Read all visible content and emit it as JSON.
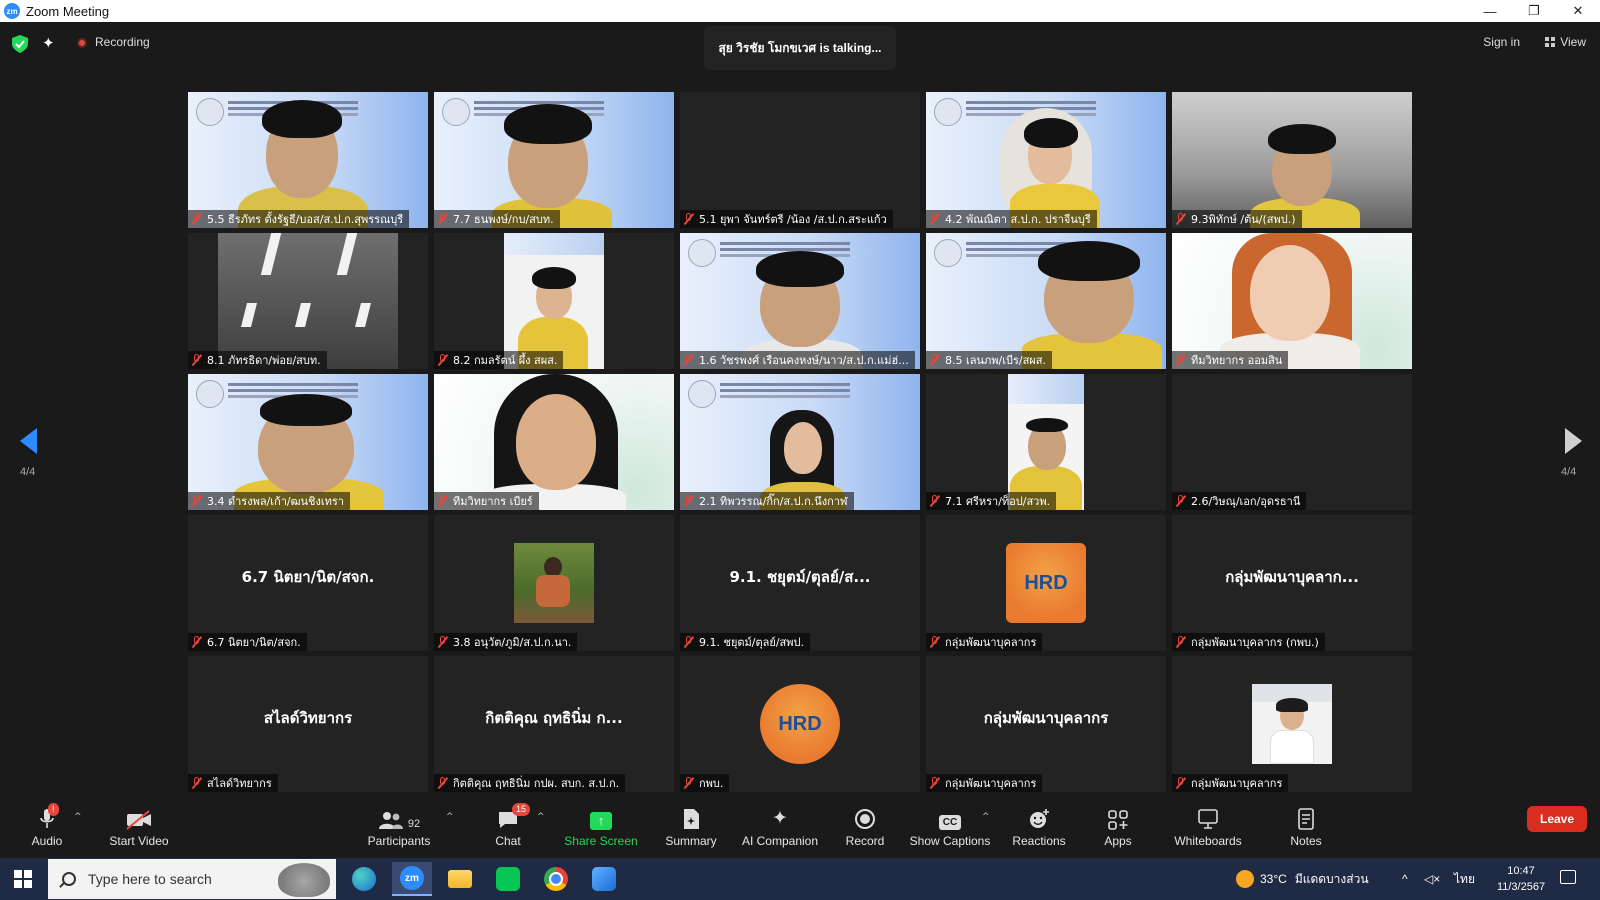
{
  "window": {
    "title": "Zoom Meeting",
    "logo_text": "zm",
    "minimize": "—",
    "restore": "❐",
    "close": "✕"
  },
  "topbar": {
    "recording": "Recording",
    "talking": "สุย วิรชัย โมกขเวศ is talking...",
    "sign_in": "Sign in",
    "view": "View"
  },
  "nav": {
    "page_left": "4/4",
    "page_right": "4/4"
  },
  "tiles": [
    {
      "type": "video",
      "name": "5.5 ธีรภัทร ตั้งรัฐธี/บอส/ส.ป.ก.สุพรรณบุรี"
    },
    {
      "type": "video",
      "name": "7.7 ธนพงษ์/กบ/สบท."
    },
    {
      "type": "video-off",
      "name": "5.1 ยุพา จันทร์ตรี /น้อง /ส.ป.ก.สระแก้ว"
    },
    {
      "type": "video",
      "name": "4.2 พัณณิตา ส.ป.ก. ปราจีนบุรี"
    },
    {
      "type": "video",
      "name": "9.3พิทักษ์ /ต้น/(สพป.)"
    },
    {
      "type": "video",
      "name": "8.1 ภัทรธิดา/พ่อย/สบท."
    },
    {
      "type": "video",
      "name": "8.2 กมลรัตน์ ผึ้ง สผส."
    },
    {
      "type": "video",
      "name": "1.6 วัชรพงศ์ เรือนคงหงษ์/นาว/ส.ป.ก.แม่ฮ่..."
    },
    {
      "type": "video",
      "name": "8.5 เลนภพ/เบีร/สผส."
    },
    {
      "type": "video",
      "name": "ทีมวิทยากร ออมสิน"
    },
    {
      "type": "video",
      "name": "3.4 ดำรงพล/เก้า/ฒนชิงเทรา"
    },
    {
      "type": "video",
      "name": "ทีมวิทยากร เบียร์"
    },
    {
      "type": "video",
      "name": "2.1 ทิพวรรณ/กิ๊ก/ส.ป.ก.นึงกาฬ"
    },
    {
      "type": "video",
      "name": "7.1 ศรีหรา/ท็อป/สวพ."
    },
    {
      "type": "video-off",
      "name": "2.6/วิษณุ/เอก/อุดรธานี"
    },
    {
      "type": "name",
      "display": "6.7 นิตยา/นิต/สจก.",
      "name": "6.7 นิตยา/นิต/สจก."
    },
    {
      "type": "photo",
      "name": "3.8 อนุวัต/ภูมิ/ส.ป.ก.นา."
    },
    {
      "type": "name",
      "display": "9.1. ชยุตม์/ตุลย์/ส...",
      "name": "9.1. ชยุตม์/ตุลย์/สพป."
    },
    {
      "type": "logo",
      "logo": "HRD",
      "name": "กลุ่มพัฒนาบุคลากร"
    },
    {
      "type": "name",
      "display": "กลุ่มพัฒนาบุคลาก...",
      "name": "กลุ่มพัฒนาบุคลากร (กพบ.)"
    },
    {
      "type": "name",
      "display": "สไลด์วิทยากร",
      "name": "สไลด์วิทยากร"
    },
    {
      "type": "name",
      "display": "กิตติคุณ ฤทธินิ่ม ก...",
      "name": "กิตติคุณ ฤทธินิ่ม กปผ. สบก. ส.ป.ก."
    },
    {
      "type": "logo-circle",
      "logo": "HRD",
      "name": "กพบ."
    },
    {
      "type": "name",
      "display": "กลุ่มพัฒนาบุคลากร",
      "name": "กลุ่มพัฒนาบุคลากร"
    },
    {
      "type": "photo2",
      "name": "กลุ่มพัฒนาบุคลากร"
    }
  ],
  "toolbar": {
    "audio": "Audio",
    "audio_badge": "!",
    "start_video": "Start Video",
    "participants": "Participants",
    "participants_count": "92",
    "chat": "Chat",
    "chat_badge": "15",
    "share_screen": "Share Screen",
    "summary": "Summary",
    "ai_companion": "AI Companion",
    "record": "Record",
    "show_captions": "Show Captions",
    "cc": "CC",
    "reactions": "Reactions",
    "apps": "Apps",
    "whiteboards": "Whiteboards",
    "notes": "Notes",
    "leave": "Leave"
  },
  "taskbar": {
    "search_placeholder": "Type here to search",
    "zoom_label": "zm",
    "weather": "33°C",
    "weather_text": "มีแดดบางส่วน",
    "lang": "ไทย",
    "time": "10:47",
    "date": "11/3/2567"
  },
  "colors": {
    "accent": "#2d8cff",
    "share_green": "#23d959",
    "leave_red": "#d92d20",
    "muted_red": "#e8453c"
  }
}
